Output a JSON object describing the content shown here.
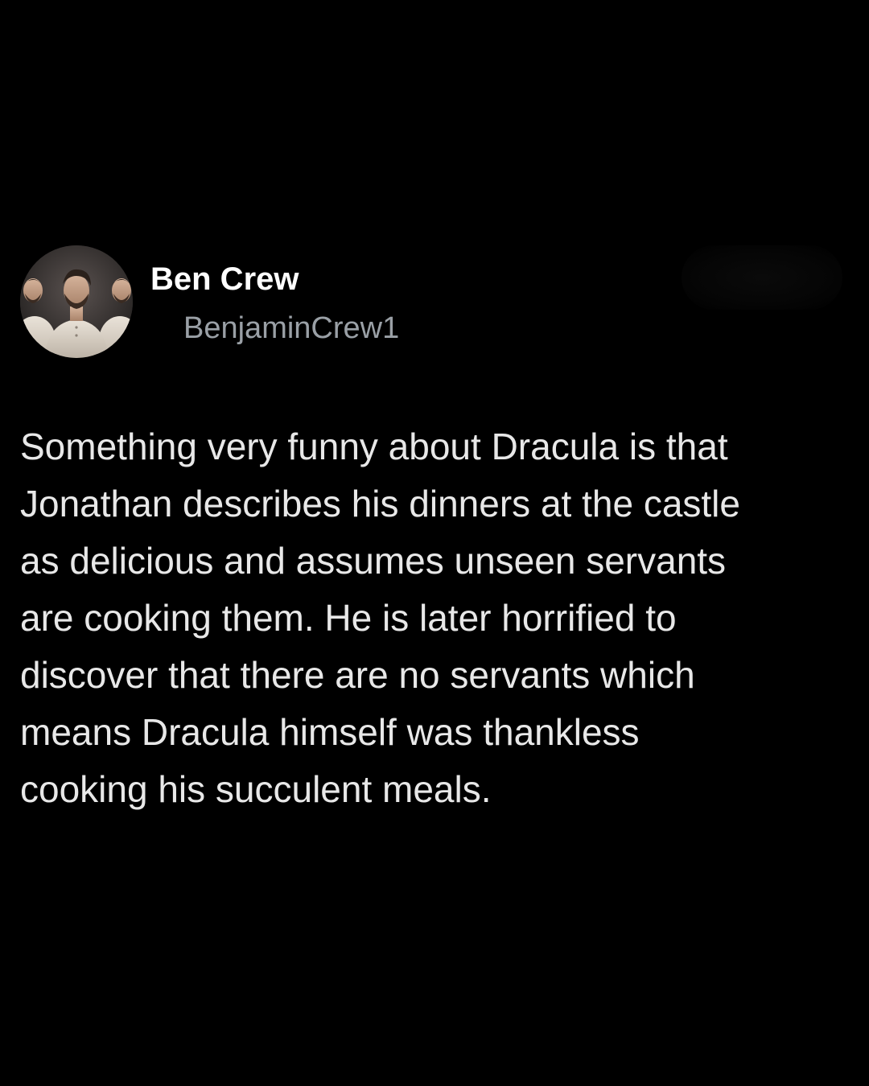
{
  "author": {
    "display_name": "Ben Crew",
    "handle": "BenjaminCrew1",
    "avatar_icon": "profile-photo-icon"
  },
  "tweet": {
    "lines": [
      "Something very funny about Dracula is that",
      "Jonathan describes his dinners at the castle",
      "as delicious and assumes unseen servants",
      "are cooking them. He is later horrified to",
      "discover that there are no servants which",
      "means Dracula himself was thankless",
      "cooking his succulent meals."
    ]
  },
  "colors": {
    "background": "#000000",
    "name": "#ffffff",
    "handle": "#9aa0a6",
    "text": "#e8e8e8"
  }
}
